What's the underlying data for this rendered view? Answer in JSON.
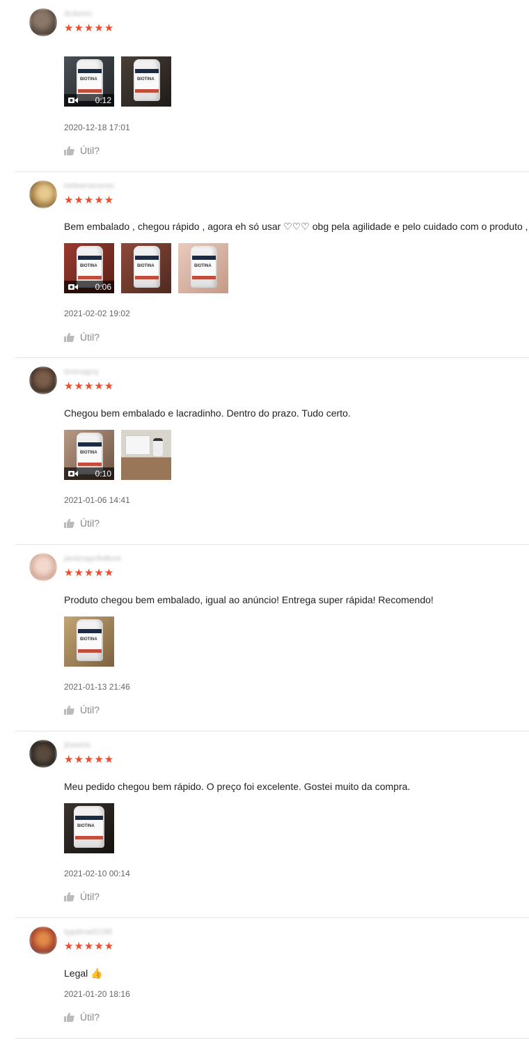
{
  "useful_label": "Útil?",
  "colors": {
    "star": "#ee4d2d",
    "divider": "#e5e5e5"
  },
  "reviews": [
    {
      "username": "dcdanro",
      "stars": "★★★★★",
      "comment": "",
      "media": [
        {
          "type": "video",
          "duration": "0:12",
          "bg": "#3a3f44"
        },
        {
          "type": "image",
          "bg": "#3b3430"
        }
      ],
      "date": "2020-12-18 17:01",
      "avatar_color": "#6b5a4d"
    },
    {
      "username": "belleemeneres",
      "stars": "★★★★★",
      "comment": "Bem embalado , chegou rápido  , agora eh só usar ♡♡♡ obg pela agilidade e pelo cuidado com o produto ,",
      "media": [
        {
          "type": "video",
          "duration": "0:06",
          "bg": "#7a2f26"
        },
        {
          "type": "image",
          "bg": "#6e3a2e"
        },
        {
          "type": "image",
          "bg": "#d9b8a8"
        }
      ],
      "date": "2021-02-02 19:02",
      "avatar_color": "#c9a66b"
    },
    {
      "username": "lorenagnq",
      "stars": "★★★★★",
      "comment": "Chegou bem embalado e lacradinho. Dentro do prazo. Tudo certo.",
      "media": [
        {
          "type": "video",
          "duration": "0:10",
          "bg": "#8a6a52"
        },
        {
          "type": "image",
          "bg": "#9d7a5c"
        }
      ],
      "date": "2021-01-06 14:41",
      "avatar_color": "#4d3a2f"
    },
    {
      "username": "janainapcfedkow",
      "stars": "★★★★★",
      "comment": "Produto chegou bem embalado, igual ao anúncio! Entrega super rápida! Recomendo!",
      "media": [
        {
          "type": "image",
          "bg": "#a88a5e"
        }
      ],
      "date": "2021-01-13 21:46",
      "avatar_color": "#d8b3a3"
    },
    {
      "username": "jlnostrlo",
      "stars": "★★★★★",
      "comment": "Meu pedido chegou bem rápido. O preço foi excelente. Gostei muito da compra.",
      "media": [
        {
          "type": "image",
          "bg": "#2e2a28"
        }
      ],
      "date": "2021-02-10 00:14",
      "avatar_color": "#2f2a26"
    },
    {
      "username": "lygabrael2188",
      "stars": "★★★★★",
      "comment": "Legal 👍",
      "media": [],
      "date": "2021-01-20 18:16",
      "avatar_color": "#c4562f"
    }
  ]
}
